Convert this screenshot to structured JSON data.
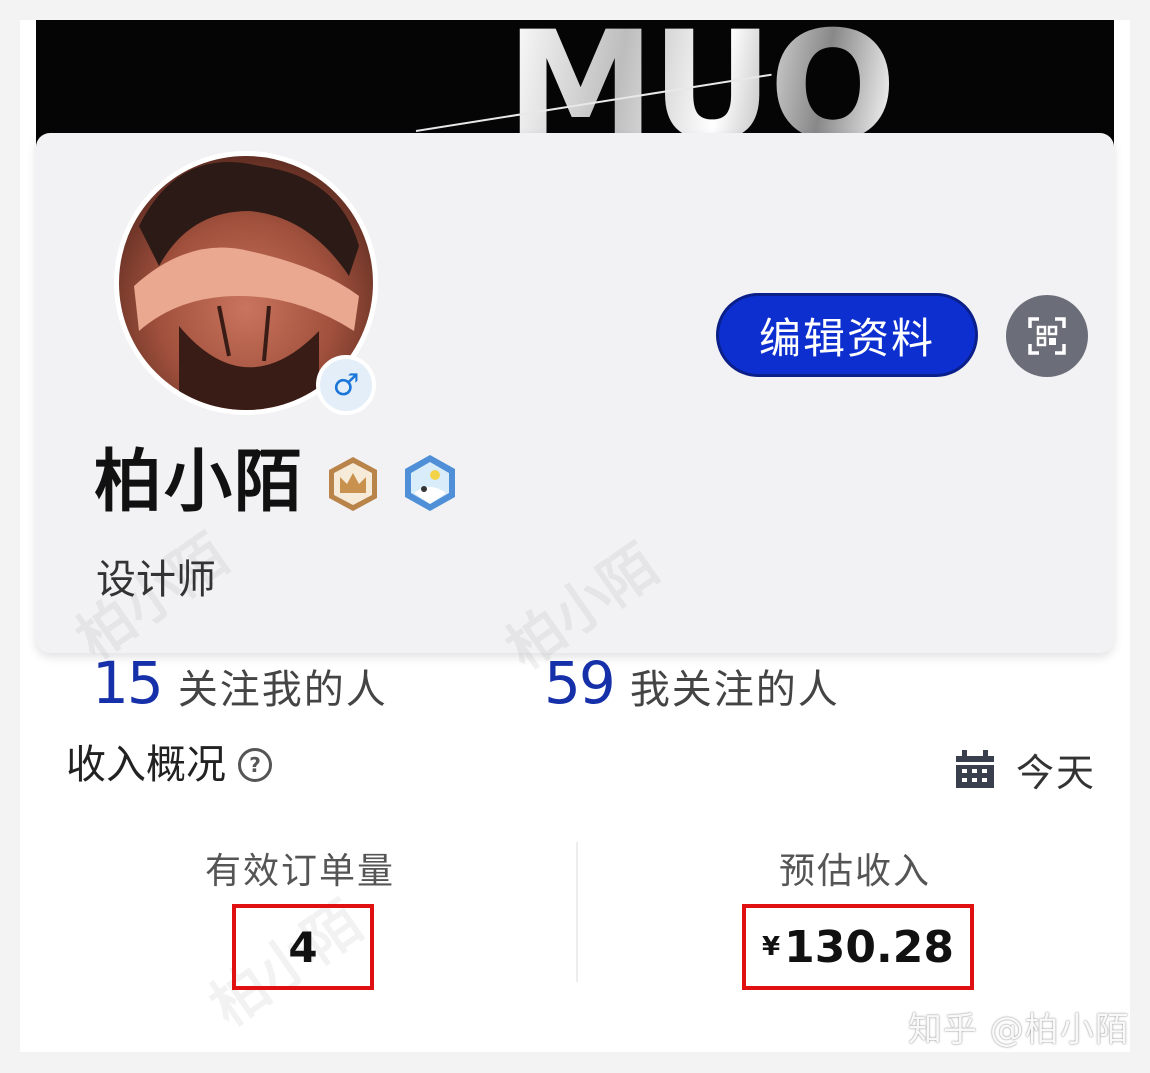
{
  "banner": {
    "text": "MUO"
  },
  "profile": {
    "gender_symbol": "♂",
    "edit_label": "编辑资料",
    "name": "柏小陌",
    "bio": "设计师",
    "followers": {
      "count": "15",
      "label": "关注我的人"
    },
    "following": {
      "count": "59",
      "label": "我关注的人"
    },
    "badges": [
      "crown-badge",
      "hexagon-badge"
    ]
  },
  "income": {
    "title": "收入概况",
    "help_symbol": "?",
    "date_label": "今天",
    "orders": {
      "label": "有效订单量",
      "value": "4"
    },
    "estimated": {
      "label": "预估收入",
      "currency": "¥",
      "value": "130.28"
    }
  },
  "watermark": {
    "background_text": "柏小陌",
    "source": "知乎 @柏小陌"
  },
  "colors": {
    "accent_blue": "#0d2fd0",
    "number_blue": "#1530a8",
    "highlight_red": "#e01010"
  }
}
